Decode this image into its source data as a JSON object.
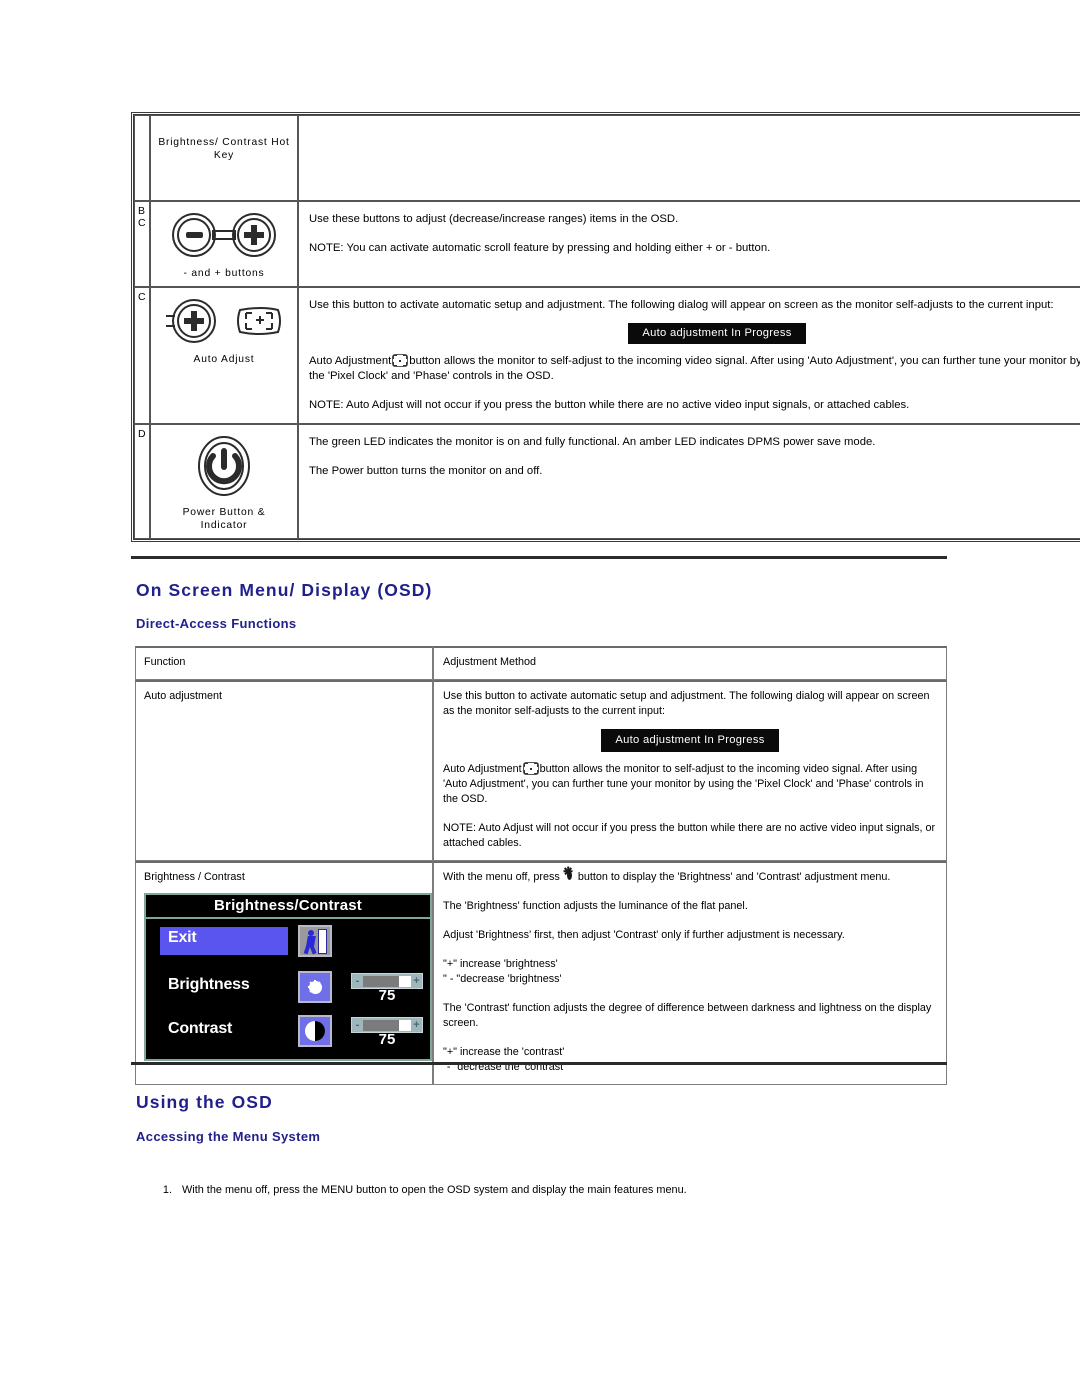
{
  "table1": {
    "rows": [
      {
        "letter": "",
        "icon": "brightness-contrast-hotkey-icon",
        "caption": "Brightness/ Contrast Hot Key",
        "paragraphs": []
      },
      {
        "letter": "B\nC",
        "icon": "minus-plus-buttons-icon",
        "caption": "- and + buttons",
        "paragraphs": [
          "Use these buttons to adjust (decrease/increase ranges) items in the OSD.",
          "NOTE: You can activate automatic scroll feature by pressing and holding either + or - button."
        ]
      },
      {
        "letter": "C",
        "icon": "auto-adjust-icon",
        "caption": "Auto Adjust",
        "intro": "Use this button to activate automatic setup and adjustment. The following dialog will appear on screen as the monitor self-adjusts to the current input:",
        "banner": "Auto adjustment In Progress",
        "body_pre": "Auto Adjustment",
        "body_post": "button allows the monitor to self-adjust to the incoming video signal. After using 'Auto Adjustment', you can further tune your monitor by using the 'Pixel Clock' and 'Phase' controls in the OSD.",
        "note": "NOTE: Auto Adjust will not occur if you press the button while there are no active video input signals, or attached cables."
      },
      {
        "letter": "D",
        "icon": "power-button-icon",
        "caption": "Power Button & Indicator",
        "paragraphs": [
          "The green LED indicates the monitor is on and fully functional. An amber LED indicates DPMS power save mode.",
          "The Power button turns the monitor on and off."
        ]
      }
    ]
  },
  "section1": {
    "heading": "On Screen Menu/ Display (OSD)",
    "subheading": "Direct-Access Functions"
  },
  "table2": {
    "headers": {
      "function": "Function",
      "method": "Adjustment Method"
    },
    "row_auto": {
      "function": "Auto adjustment",
      "intro": "Use this button to activate automatic setup and adjustment. The following dialog will appear on screen as the monitor self-adjusts to the current input:",
      "banner": "Auto adjustment In Progress",
      "body_pre": "Auto Adjustment",
      "body_post": "button allows the monitor to self-adjust to the incoming video signal. After using 'Auto Adjustment', you can further tune your monitor by using the 'Pixel Clock' and 'Phase' controls in the OSD.",
      "note": "NOTE: Auto Adjust will not occur if you press the button while there are no active video input signals, or attached cables."
    },
    "row_brightness": {
      "function": "Brightness / Contrast",
      "line1_pre": "With the menu off, press",
      "line1_post": "button to display the 'Brightness' and 'Contrast' adjustment menu.",
      "line2": "The 'Brightness' function adjusts the luminance of the flat panel.",
      "line3": "Adjust 'Brightness' first, then adjust 'Contrast' only if further adjustment is necessary.",
      "line4a": "\"+\" increase 'brightness'",
      "line4b": "\" - \"decrease 'brightness'",
      "line5": "The 'Contrast' function adjusts the degree of difference between darkness and lightness on the display screen.",
      "line6a": "\"+\" increase the 'contrast'",
      "line6b": "\"-\" decrease the 'contrast'"
    }
  },
  "osd_panel": {
    "title": "Brightness/Contrast",
    "exit_label": "Exit",
    "brightness_label": "Brightness",
    "brightness_value": "75",
    "contrast_label": "Contrast",
    "contrast_value": "75",
    "minus": "-",
    "plus": "+"
  },
  "section2": {
    "heading": "Using the OSD",
    "subheading": "Accessing the Menu System",
    "steps": [
      {
        "num": "1.",
        "text": "With the menu off, press the MENU button to open the OSD system and display the main features menu."
      }
    ]
  },
  "colors": {
    "heading_blue": "#22218c",
    "osd_highlight": "#5a55ee",
    "osd_border": "#7fa89a",
    "banner_bg": "#0a0a0a"
  }
}
